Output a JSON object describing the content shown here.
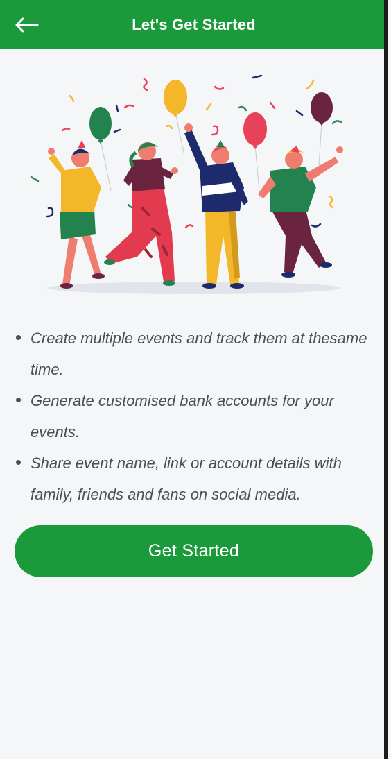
{
  "header": {
    "title": "Let's Get Started",
    "back_icon": "arrow-left-icon",
    "background_color": "#1a9a3a"
  },
  "illustration": {
    "icon": "party-celebration-illustration"
  },
  "features": [
    {
      "text": "Create multiple events and track them at thesame time."
    },
    {
      "text": "Generate customised bank accounts for your events."
    },
    {
      "text": "Share event name, link or account details with family, friends and fans on social media."
    }
  ],
  "cta": {
    "label": "Get Started",
    "color": "#1a9a3a"
  }
}
